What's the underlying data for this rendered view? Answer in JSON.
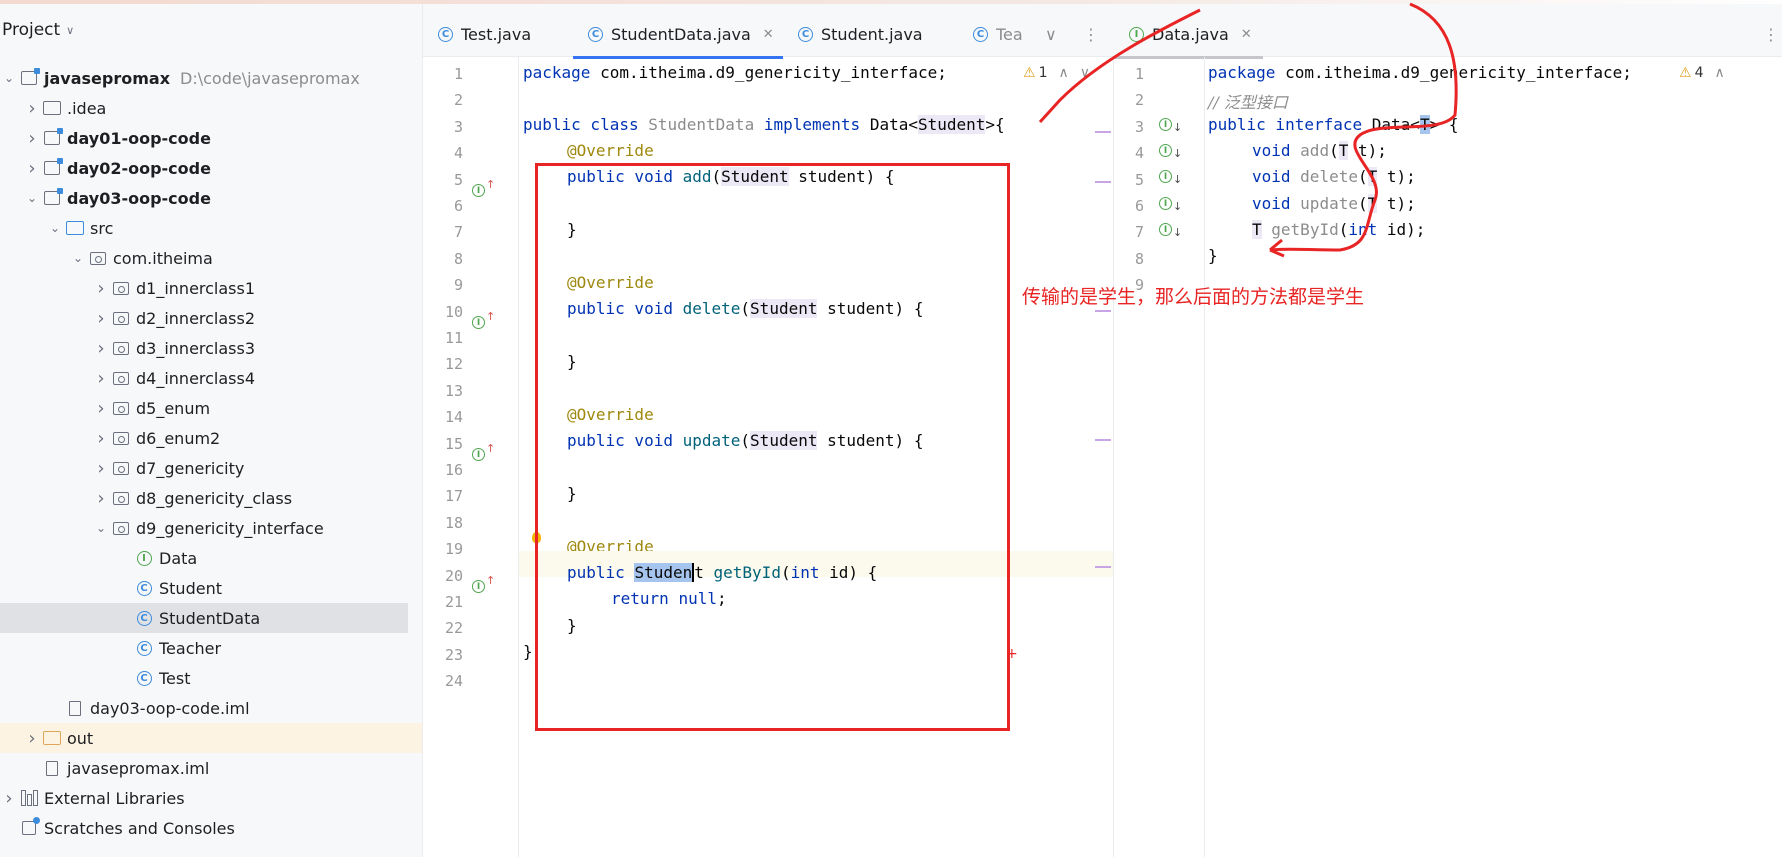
{
  "project_panel": {
    "title": "Project",
    "tree": [
      {
        "label": "javasepromax",
        "path": "D:\\code\\javasepromax",
        "indent": 0,
        "arrow": "down",
        "icon": "module-icon",
        "bold": true
      },
      {
        "label": ".idea",
        "indent": 1,
        "arrow": "right",
        "icon": "folder-icon"
      },
      {
        "label": "day01-oop-code",
        "indent": 1,
        "arrow": "right",
        "icon": "module-icon",
        "bold": true
      },
      {
        "label": "day02-oop-code",
        "indent": 1,
        "arrow": "right",
        "icon": "module-icon",
        "bold": true
      },
      {
        "label": "day03-oop-code",
        "indent": 1,
        "arrow": "down",
        "icon": "module-icon",
        "bold": true
      },
      {
        "label": "src",
        "indent": 2,
        "arrow": "down",
        "icon": "source-folder-icon"
      },
      {
        "label": "com.itheima",
        "indent": 3,
        "arrow": "down",
        "icon": "package-icon"
      },
      {
        "label": "d1_innerclass1",
        "indent": 4,
        "arrow": "right",
        "icon": "package-icon"
      },
      {
        "label": "d2_innerclass2",
        "indent": 4,
        "arrow": "right",
        "icon": "package-icon"
      },
      {
        "label": "d3_innerclass3",
        "indent": 4,
        "arrow": "right",
        "icon": "package-icon"
      },
      {
        "label": "d4_innerclass4",
        "indent": 4,
        "arrow": "right",
        "icon": "package-icon"
      },
      {
        "label": "d5_enum",
        "indent": 4,
        "arrow": "right",
        "icon": "package-icon"
      },
      {
        "label": "d6_enum2",
        "indent": 4,
        "arrow": "right",
        "icon": "package-icon"
      },
      {
        "label": "d7_genericity",
        "indent": 4,
        "arrow": "right",
        "icon": "package-icon"
      },
      {
        "label": "d8_genericity_class",
        "indent": 4,
        "arrow": "right",
        "icon": "package-icon"
      },
      {
        "label": "d9_genericity_interface",
        "indent": 4,
        "arrow": "down",
        "icon": "package-icon"
      },
      {
        "label": "Data",
        "indent": 5,
        "arrow": "",
        "icon": "interface-icon"
      },
      {
        "label": "Student",
        "indent": 5,
        "arrow": "",
        "icon": "class-icon"
      },
      {
        "label": "StudentData",
        "indent": 5,
        "arrow": "",
        "icon": "class-icon",
        "selected": true
      },
      {
        "label": "Teacher",
        "indent": 5,
        "arrow": "",
        "icon": "class-icon"
      },
      {
        "label": "Test",
        "indent": 5,
        "arrow": "",
        "icon": "class-icon"
      },
      {
        "label": "day03-oop-code.iml",
        "indent": 2,
        "arrow": "",
        "icon": "file-icon"
      },
      {
        "label": "out",
        "indent": 1,
        "arrow": "right",
        "icon": "excluded-folder-icon",
        "excluded": true
      },
      {
        "label": "javasepromax.iml",
        "indent": 1,
        "arrow": "",
        "icon": "file-icon"
      },
      {
        "label": "External Libraries",
        "indent": 0,
        "arrow": "right",
        "icon": "library-icon"
      },
      {
        "label": "Scratches and Consoles",
        "indent": 0,
        "arrow": "",
        "icon": "scratch-icon"
      }
    ]
  },
  "left_tabs": [
    "Test.java",
    "StudentData.java",
    "Student.java",
    "Tea"
  ],
  "right_tabs": [
    "Data.java"
  ],
  "left_editor": {
    "warning_count": "1",
    "lines": [
      "1",
      "2",
      "3",
      "4",
      "5",
      "6",
      "7",
      "8",
      "9",
      "10",
      "11",
      "12",
      "13",
      "14",
      "15",
      "16",
      "17",
      "18",
      "19",
      "20",
      "21",
      "22",
      "23",
      "24"
    ],
    "code": {
      "l1_kw": "package",
      "l1_rest": " com.itheima.d9_genericity_interface;",
      "l3_kw1": "public class",
      "l3_cls": "StudentData",
      "l3_kw2": "implements",
      "l3_iface": "Data",
      "l3_lt": "<",
      "l3_arg": "Student",
      "l3_gt": ">{",
      "override": "@Override",
      "pv": "public void",
      "add": "add",
      "delete": "delete",
      "update": "update",
      "open": "(",
      "param_type": "Student",
      "param_rest": " student) {",
      "close": "}",
      "l20_kw": "public",
      "l20_type_a": "Studen",
      "l20_type_b": "t",
      "l20_fn": "getById",
      "l20_int": "int",
      "l20_rest": " id) {",
      "l21_kw": "return",
      "l21_null": "null",
      "l21_semi": ";"
    }
  },
  "right_editor": {
    "warning_count": "4",
    "lines": [
      "1",
      "2",
      "3",
      "4",
      "5",
      "6",
      "7",
      "8",
      "9"
    ],
    "code": {
      "l1_kw": "package",
      "l1_rest": " com.itheima.d9_genericity_interface;",
      "l2_comment": "// 泛型接口",
      "l3_kw": "public interface",
      "l3_name": "Data",
      "l3_lt": "<",
      "l3_T": "T",
      "l3_gt": "> {",
      "void": "void",
      "add": "add",
      "delete": "delete",
      "update": "update",
      "T": "T",
      "param": " t);",
      "getById": "getById",
      "int": "int",
      "id": " id);",
      "close": "}"
    }
  },
  "annotation": {
    "note": "传输的是学生，那么后面的方法都是学生",
    "color": "#e82424"
  }
}
